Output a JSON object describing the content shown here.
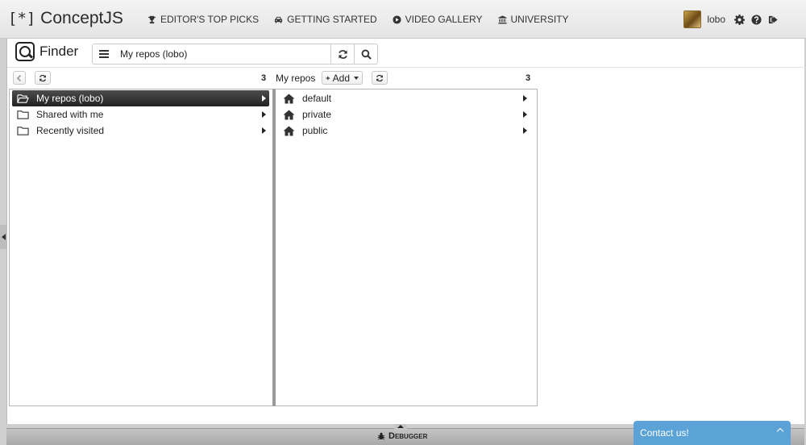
{
  "app": {
    "brand_mark": "[*]",
    "brand_name": "ConceptJS"
  },
  "nav": {
    "links": [
      {
        "label": "EDITOR'S TOP PICKS",
        "icon": "trophy-icon"
      },
      {
        "label": "GETTING STARTED",
        "icon": "car-icon"
      },
      {
        "label": "VIDEO GALLERY",
        "icon": "play-circle-icon"
      },
      {
        "label": "UNIVERSITY",
        "icon": "bank-icon"
      }
    ]
  },
  "user": {
    "name": "lobo",
    "actions": [
      "gear-icon",
      "help-icon",
      "sign-out-icon"
    ]
  },
  "finder": {
    "title": "Finder",
    "path": "My repos (lobo)"
  },
  "columns": [
    {
      "count": "3",
      "items": [
        {
          "label": "My repos (lobo)",
          "icon": "folder-open-icon",
          "selected": true
        },
        {
          "label": "Shared with me",
          "icon": "folder-icon",
          "selected": false
        },
        {
          "label": "Recently visited",
          "icon": "folder-icon",
          "selected": false
        }
      ]
    },
    {
      "label": "My repos",
      "add_label": "Add",
      "count": "3",
      "items": [
        {
          "label": "default",
          "icon": "home-icon"
        },
        {
          "label": "private",
          "icon": "home-icon"
        },
        {
          "label": "public",
          "icon": "home-icon"
        }
      ]
    }
  ],
  "debugger": {
    "label": "Debugger"
  },
  "contact": {
    "label": "Contact us!"
  },
  "colors": {
    "selected_row": "#2e2e2e",
    "contact_bg": "#5ba3d6",
    "navbar_bg": "#ececec"
  }
}
